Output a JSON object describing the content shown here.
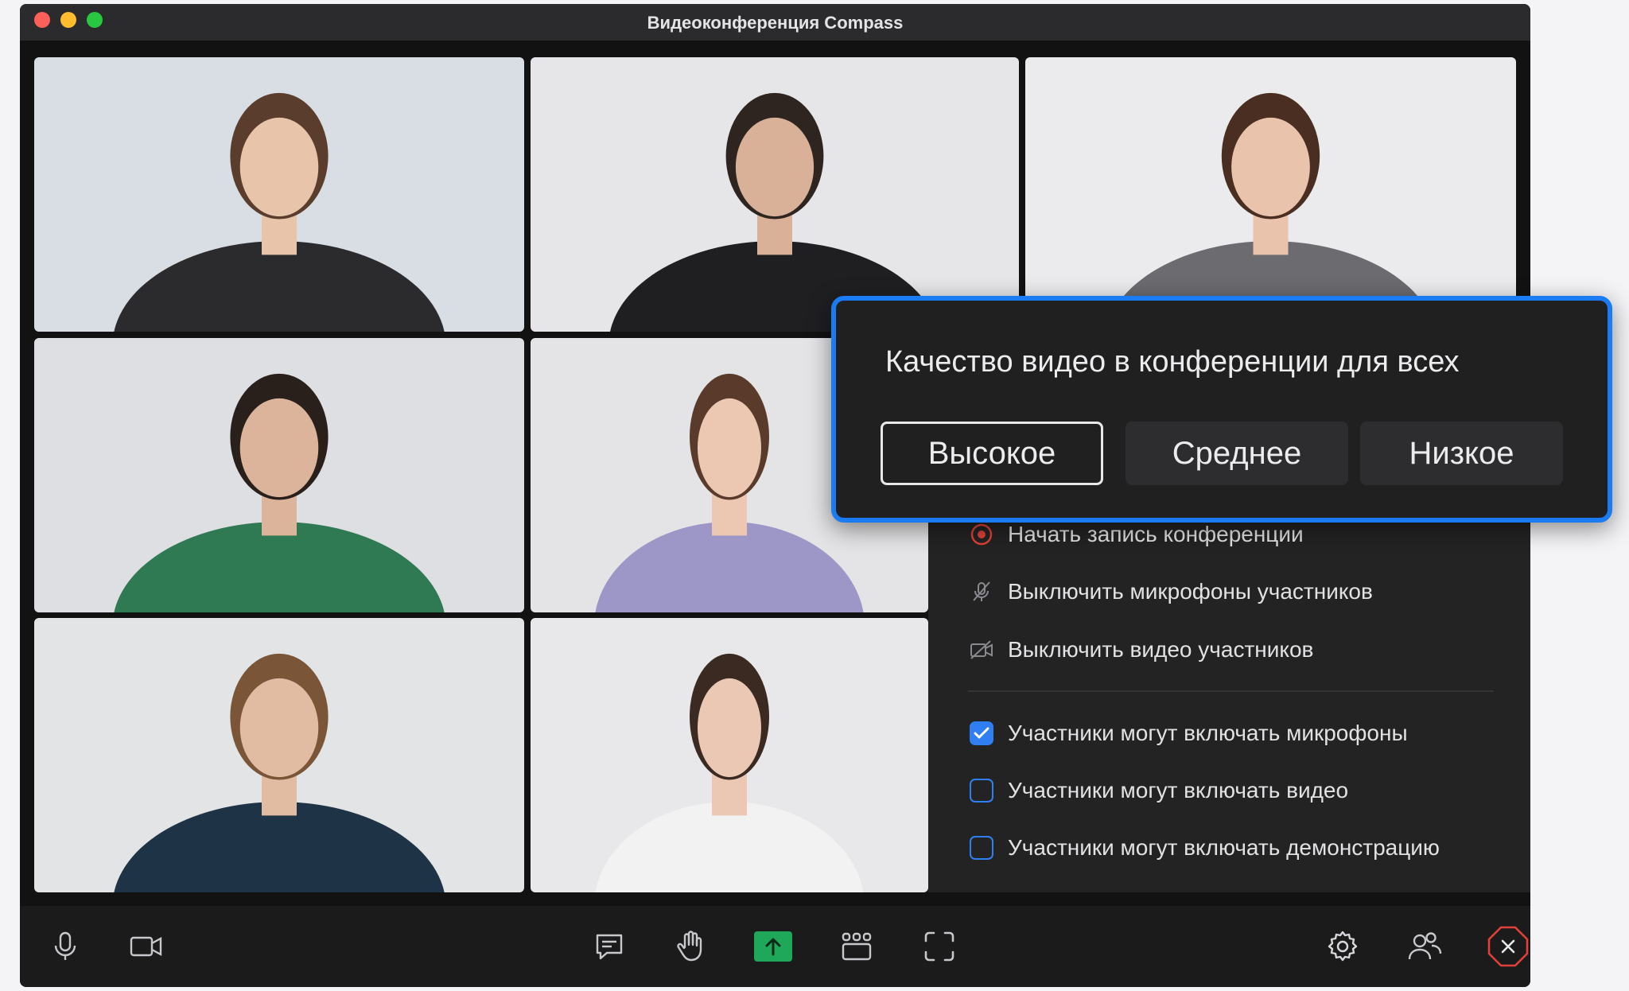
{
  "window": {
    "title": "Видеоконференция Compass"
  },
  "traffic_lights": {
    "close_color": "#fe5f57",
    "minimize_color": "#febc2e",
    "maximize_color": "#28c840"
  },
  "quality_popup": {
    "title": "Качество видео в конференции для всех",
    "options": [
      "Высокое",
      "Среднее",
      "Низкое"
    ],
    "selected": "Высокое"
  },
  "host_panel": {
    "actions": [
      {
        "label": "Начать запись конференции",
        "icon": "record-icon"
      },
      {
        "label": "Выключить микрофоны участников",
        "icon": "mic-off-icon"
      },
      {
        "label": "Выключить видео участников",
        "icon": "video-off-icon"
      }
    ],
    "permissions": [
      {
        "label": "Участники могут включать микрофоны",
        "checked": true
      },
      {
        "label": "Участники могут включать видео",
        "checked": false
      },
      {
        "label": "Участники могут включать демонстрацию",
        "checked": false
      }
    ]
  },
  "toolbar": {
    "left": [
      "microphone-icon",
      "camera-icon"
    ],
    "center": [
      "chat-icon",
      "raise-hand-icon",
      "share-screen-icon",
      "layout-icon",
      "fullscreen-icon"
    ],
    "right": [
      "settings-icon",
      "participants-icon",
      "leave-icon"
    ]
  },
  "colors": {
    "accent_blue": "#1b7bf2",
    "share_green": "#1fa85a",
    "leave_red": "#e0403a"
  },
  "participants": [
    {
      "id": "p1",
      "shirt": "#2b2b2e",
      "hair": "#5a3d2c",
      "skin": "#e8c4ab",
      "bg": "#d9dde4"
    },
    {
      "id": "p2",
      "shirt": "#1f1f22",
      "hair": "#2e2520",
      "skin": "#d9b098",
      "bg": "#e6e6e8"
    },
    {
      "id": "p3",
      "shirt": "#6b6b70",
      "hair": "#4a2e22",
      "skin": "#eac3ac",
      "bg": "#ebebed"
    },
    {
      "id": "p4",
      "shirt": "#2f7a52",
      "hair": "#2a201b",
      "skin": "#dcb49c",
      "bg": "#dedfe3"
    },
    {
      "id": "p5",
      "shirt": "#9d97c8",
      "hair": "#5a3a2a",
      "skin": "#ecc7b2",
      "bg": "#e4e4e6"
    },
    {
      "id": "p6",
      "shirt": "#1f3347",
      "hair": "#7a5538",
      "skin": "#e2bba3",
      "bg": "#e3e4e6"
    },
    {
      "id": "p7",
      "shirt": "#f2f2f2",
      "hair": "#3b2a22",
      "skin": "#ebc8b4",
      "bg": "#e8e8ea"
    }
  ]
}
